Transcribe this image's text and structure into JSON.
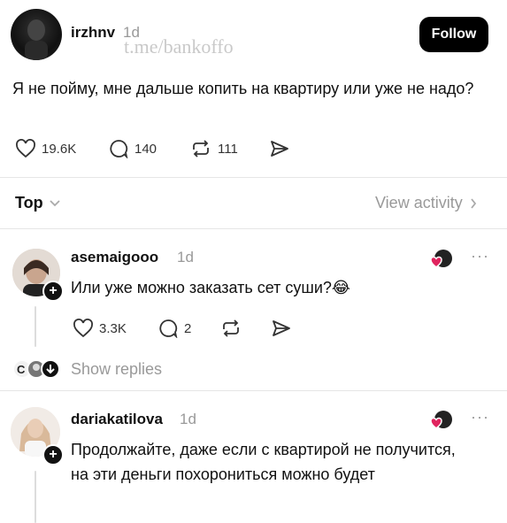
{
  "post": {
    "username": "irzhnv",
    "time": "1d",
    "watermark": "t.me/bankoffo",
    "follow_label": "Follow",
    "text": "Я не пойму, мне дальше копить на квартиру или уже не надо?",
    "likes": "19.6K",
    "comments": "140",
    "reposts": "111"
  },
  "sort": {
    "label": "Top",
    "view_activity": "View activity"
  },
  "replies": [
    {
      "username": "asemaigooo",
      "time": "1d",
      "text": "Или уже можно заказать сет суши?😂",
      "likes": "3.3K",
      "comments": "2",
      "show_replies": "Show replies"
    },
    {
      "username": "dariakatilova",
      "time": "1d",
      "text": "Продолжайте, даже если с квартирой не получится, на эти деньги похорониться можно будет"
    }
  ],
  "colors": {
    "like_heart": "#e0245e",
    "follow_bg": "#000000",
    "muted": "#999999"
  }
}
